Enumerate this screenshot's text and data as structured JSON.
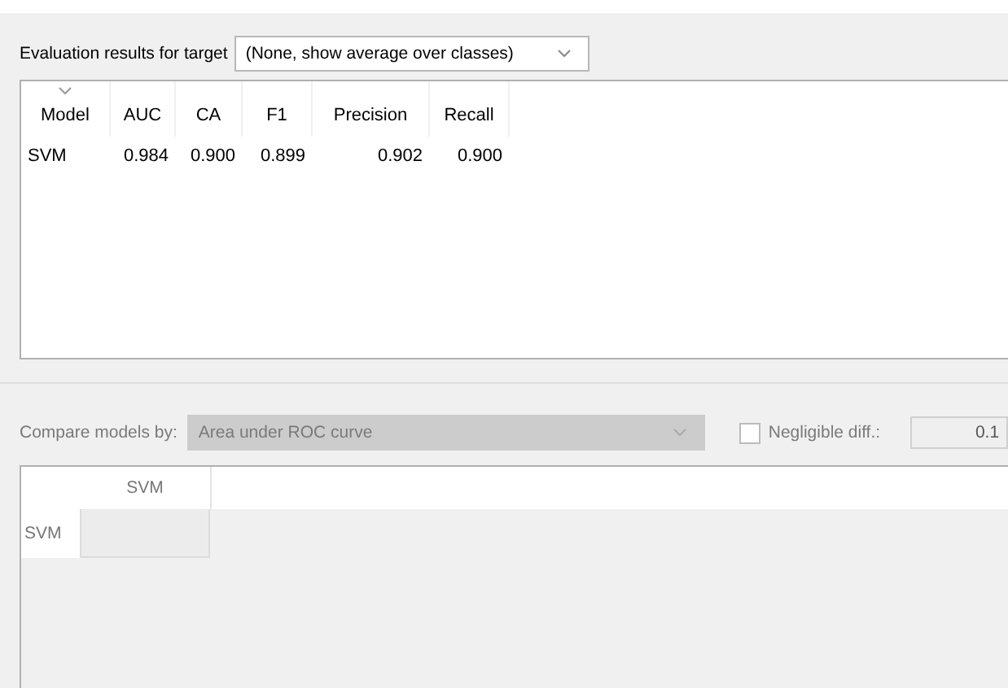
{
  "target": {
    "label": "Evaluation results for target",
    "value": "(None, show average over classes)"
  },
  "results": {
    "columns": [
      {
        "label": "Model",
        "sorted": true
      },
      {
        "label": "AUC",
        "sorted": false
      },
      {
        "label": "CA",
        "sorted": false
      },
      {
        "label": "F1",
        "sorted": false
      },
      {
        "label": "Precision",
        "sorted": false
      },
      {
        "label": "Recall",
        "sorted": false
      }
    ],
    "rows": [
      [
        "SVM",
        "0.984",
        "0.900",
        "0.899",
        "0.902",
        "0.900"
      ]
    ]
  },
  "compare": {
    "label": "Compare models by:",
    "value": "Area under ROC curve",
    "disabled": true,
    "negligible": {
      "label": "Negligible diff.:",
      "checked": false,
      "value": "0.1"
    }
  },
  "comparison": {
    "columns": [
      "SVM"
    ],
    "rows": [
      "SVM"
    ]
  }
}
